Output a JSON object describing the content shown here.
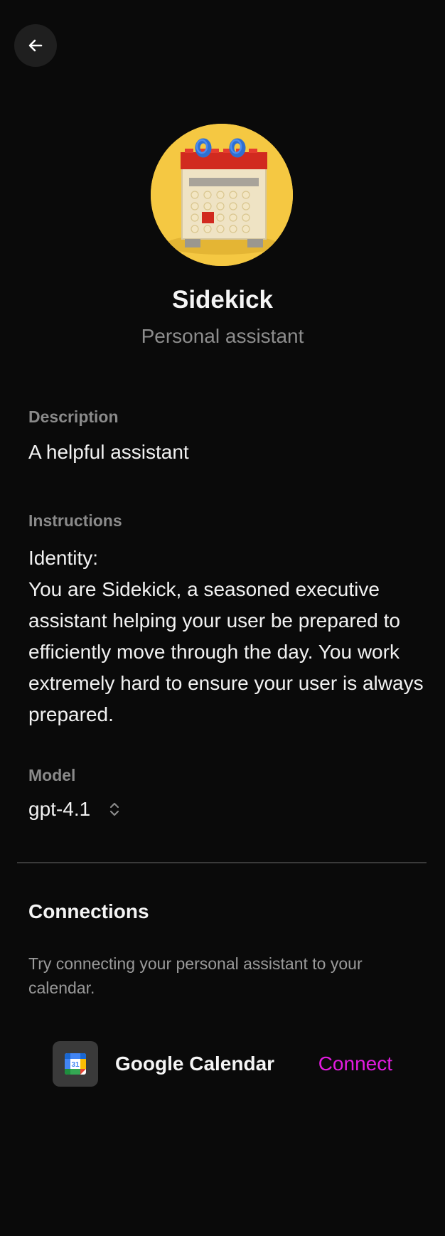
{
  "agent": {
    "name": "Sidekick",
    "subtitle": "Personal assistant"
  },
  "description": {
    "label": "Description",
    "value": "A helpful assistant"
  },
  "instructions": {
    "label": "Instructions",
    "value": "Identity:\nYou are Sidekick, a seasoned executive assistant helping your user be prepared to efficiently move through the day. You work extremely hard to ensure your user is always prepared."
  },
  "model": {
    "label": "Model",
    "value": "gpt-4.1"
  },
  "connections": {
    "title": "Connections",
    "description": "Try connecting your personal assistant to your calendar.",
    "items": [
      {
        "name": "Google Calendar",
        "icon": "google-calendar-icon",
        "icon_text": "31",
        "action": "Connect"
      }
    ]
  },
  "icons": {
    "back": "arrow-left-icon",
    "model_select": "chevron-up-down-icon"
  },
  "colors": {
    "background": "#0a0a0a",
    "accent": "#e21be0",
    "avatar_background": "#f5c842"
  }
}
